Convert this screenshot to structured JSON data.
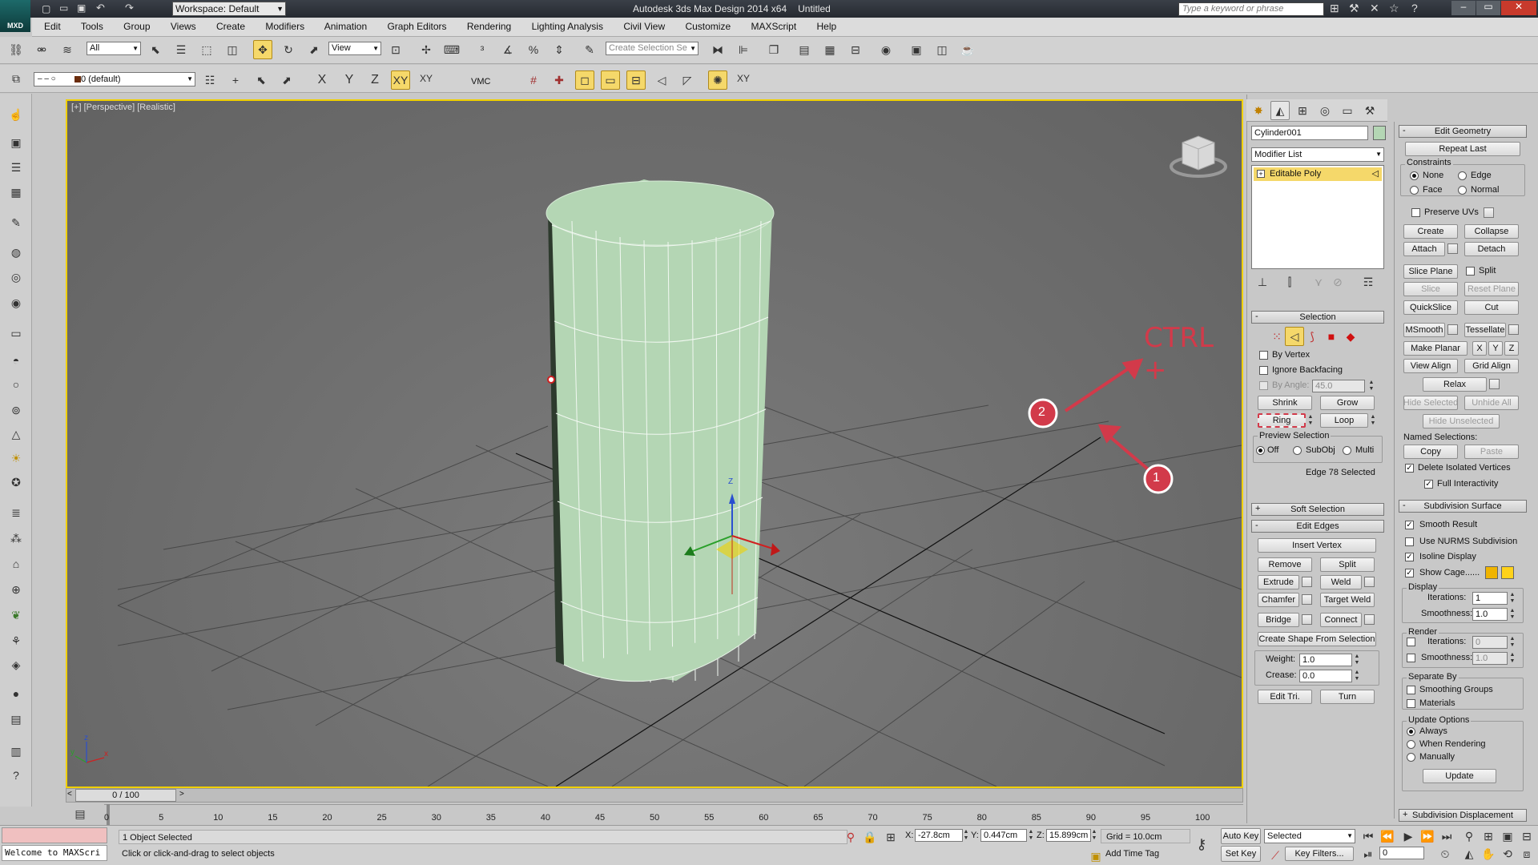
{
  "title_bar": {
    "title": "Autodesk 3ds Max Design 2014 x64",
    "doc": "Untitled",
    "workspace": "Workspace: Default",
    "search_placeholder": "Type a keyword or phrase",
    "logo": "MXD"
  },
  "menu": [
    "Edit",
    "Tools",
    "Group",
    "Views",
    "Create",
    "Modifiers",
    "Animation",
    "Graph Editors",
    "Rendering",
    "Lighting Analysis",
    "Civil View",
    "Customize",
    "MAXScript",
    "Help"
  ],
  "toolbar": {
    "filter": "All",
    "ref_coord": "View",
    "sel_set_placeholder": "Create Selection Se",
    "layer": "0 (default)",
    "x": "X",
    "y": "Y",
    "z": "Z",
    "xy": "XY",
    "xy2": "XY",
    "vmc": "VMC"
  },
  "viewport": {
    "label": "[+] [Perspective] [Realistic]",
    "gizmo_z": "Z",
    "axis_x": "x",
    "axis_y": "y",
    "axis_z": "z"
  },
  "annotations": {
    "ctrl": "CTRL +",
    "one": "1",
    "two": "2"
  },
  "command_panel": {
    "object_name": "Cylinder001",
    "modifier_list": "Modifier List",
    "stack_item": "Editable Poly",
    "selection": {
      "header": "Selection",
      "by_vertex": "By Vertex",
      "ignore_backfacing": "Ignore Backfacing",
      "by_angle": "By Angle:",
      "angle_value": "45.0",
      "shrink": "Shrink",
      "grow": "Grow",
      "ring": "Ring",
      "loop": "Loop",
      "preview": "Preview Selection",
      "off": "Off",
      "subobj": "SubObj",
      "multi": "Multi",
      "status": "Edge 78 Selected"
    },
    "soft_selection": "Soft Selection",
    "edit_edges": {
      "header": "Edit Edges",
      "insert_vertex": "Insert Vertex",
      "remove": "Remove",
      "split": "Split",
      "extrude": "Extrude",
      "weld": "Weld",
      "chamfer": "Chamfer",
      "target_weld": "Target Weld",
      "bridge": "Bridge",
      "connect": "Connect",
      "create_shape": "Create Shape From Selection",
      "weight_label": "Weight:",
      "weight_value": "1.0",
      "crease_label": "Crease:",
      "crease_value": "0.0",
      "edit_tri": "Edit Tri.",
      "turn": "Turn"
    }
  },
  "edit_geometry": {
    "header": "Edit Geometry",
    "repeat_last": "Repeat Last",
    "constraints": "Constraints",
    "none": "None",
    "edge": "Edge",
    "face": "Face",
    "normal": "Normal",
    "preserve_uvs": "Preserve UVs",
    "create": "Create",
    "collapse": "Collapse",
    "attach": "Attach",
    "detach": "Detach",
    "slice_plane": "Slice Plane",
    "split": "Split",
    "slice": "Slice",
    "reset_plane": "Reset Plane",
    "quickslice": "QuickSlice",
    "cut": "Cut",
    "msmooth": "MSmooth",
    "tessellate": "Tessellate",
    "make_planar": "Make Planar",
    "x": "X",
    "y": "Y",
    "z": "Z",
    "view_align": "View Align",
    "grid_align": "Grid Align",
    "relax": "Relax",
    "hide_selected": "Hide Selected",
    "unhide_all": "Unhide All",
    "hide_unselected": "Hide Unselected",
    "named_selections": "Named Selections:",
    "copy": "Copy",
    "paste": "Paste",
    "delete_isolated": "Delete Isolated Vertices",
    "full_interactivity": "Full Interactivity"
  },
  "subdivision": {
    "header": "Subdivision Surface",
    "smooth_result": "Smooth Result",
    "use_nurms": "Use NURMS Subdivision",
    "isoline": "Isoline Display",
    "show_cage": "Show Cage......",
    "display": "Display",
    "iterations": "Iterations:",
    "iter_value": "1",
    "smoothness": "Smoothness:",
    "smooth_value": "1.0",
    "render": "Render",
    "r_iter_value": "0",
    "r_smooth_value": "1.0",
    "separate_by": "Separate By",
    "smoothing_groups": "Smoothing Groups",
    "materials": "Materials",
    "update_options": "Update Options",
    "always": "Always",
    "when_rendering": "When Rendering",
    "manually": "Manually",
    "update": "Update",
    "displacement": "Subdivision Displacement",
    "cage_color_1": "#f0b400",
    "cage_color_2": "#ffd21a"
  },
  "timeline": {
    "frame": "0 / 100",
    "ticks": [
      "0",
      "5",
      "10",
      "15",
      "20",
      "25",
      "30",
      "35",
      "40",
      "45",
      "50",
      "55",
      "60",
      "65",
      "70",
      "75",
      "80",
      "85",
      "90",
      "95",
      "100"
    ]
  },
  "status_bar": {
    "maxscript": "Welcome to MAXScri",
    "selected": "1 Object Selected",
    "prompt": "Click or click-and-drag to select objects",
    "x_label": "X:",
    "x_value": "-27.8cm",
    "y_label": "Y:",
    "y_value": "0.447cm",
    "z_label": "Z:",
    "z_value": "15.899cm",
    "grid": "Grid = 10.0cm",
    "add_time_tag": "Add Time Tag",
    "auto_key": "Auto Key",
    "set_key": "Set Key",
    "key_mode": "Selected",
    "key_filters": "Key Filters...",
    "frame_value": "0"
  },
  "colors": {
    "viewport_bg": "#6e6e6e",
    "accent_yellow": "#f5d86a",
    "annotation_red": "#d23a4a",
    "cylinder": "#b4d6b4"
  }
}
